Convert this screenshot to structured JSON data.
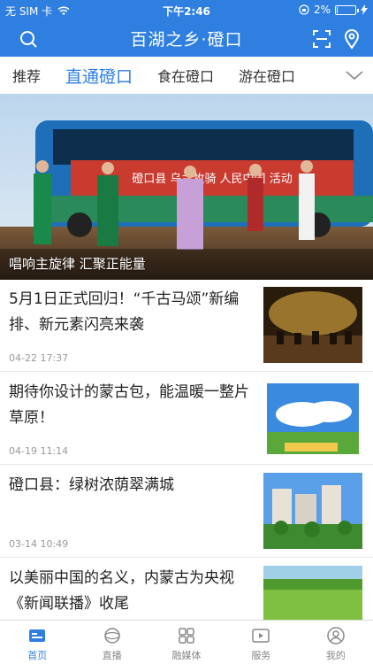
{
  "status": {
    "carrier": "无 SIM 卡",
    "time": "下午2:46",
    "battery": "2%"
  },
  "header": {
    "title": "百湖之乡·磴口"
  },
  "tabs": [
    {
      "label": "推荐"
    },
    {
      "label": "直通磴口"
    },
    {
      "label": "食在磴口"
    },
    {
      "label": "游在磴口"
    }
  ],
  "banner": {
    "caption": "唱响主旋律 汇聚正能量",
    "bus_banner_text": "磴口县 乌兰牧骑 人民中国 活动"
  },
  "news": [
    {
      "title": "5月1日正式回归！“千古马颂”新编排、新元素闪亮来袭",
      "time": "04-22 17:37"
    },
    {
      "title": "期待你设计的蒙古包，能温暖一整片草原！",
      "time": "04-19 11:14"
    },
    {
      "title": "磴口县：绿树浓荫翠满城",
      "time": "03-14 10:49"
    },
    {
      "title": "以美丽中国的名义，内蒙古为央视《新闻联播》收尾",
      "time": ""
    }
  ],
  "bottom_nav": [
    {
      "label": "首页"
    },
    {
      "label": "直播"
    },
    {
      "label": "融媒体"
    },
    {
      "label": "服务"
    },
    {
      "label": "我的"
    }
  ],
  "colors": {
    "accent": "#2f7fe0"
  }
}
